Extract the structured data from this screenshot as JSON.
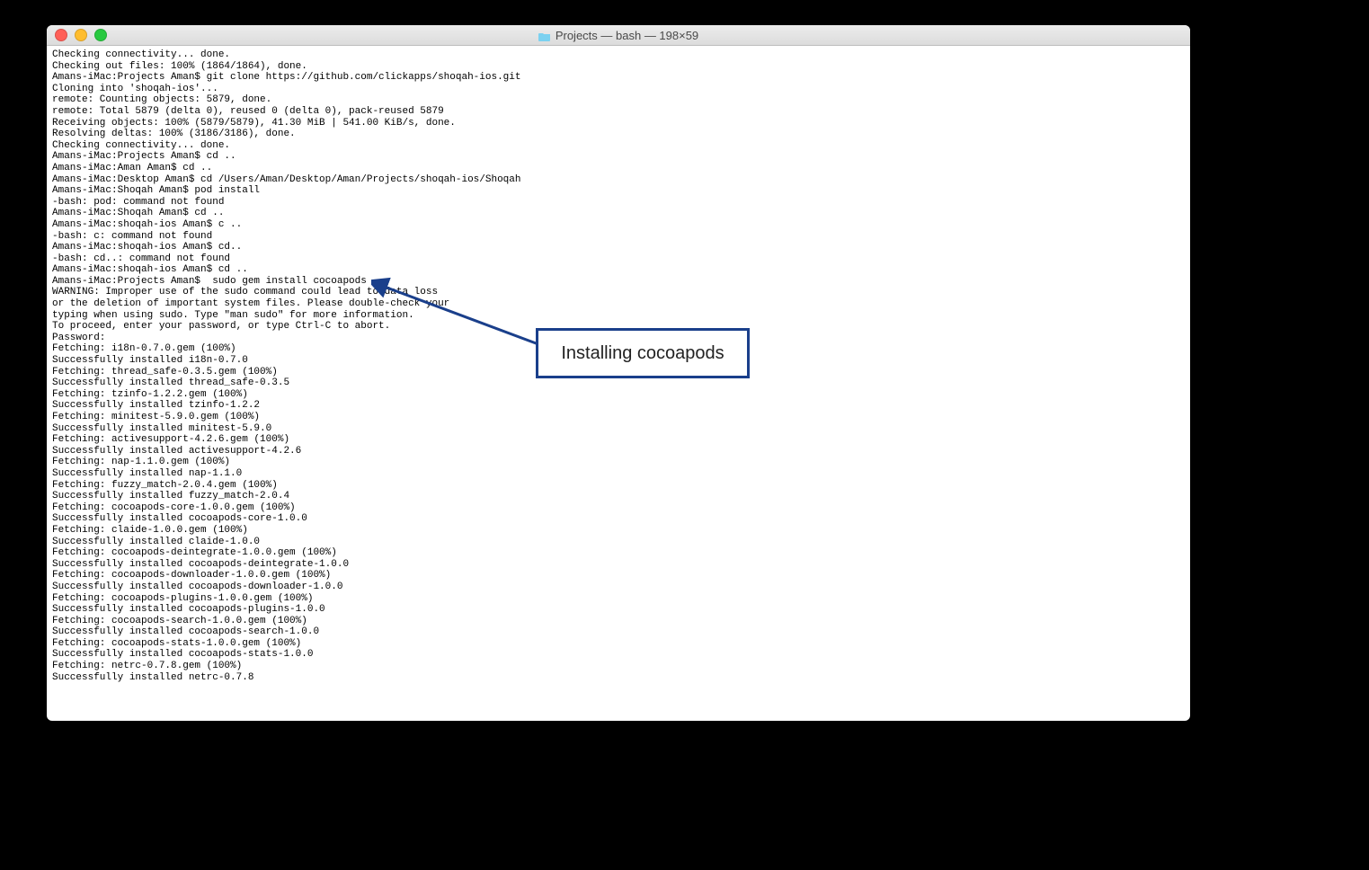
{
  "window": {
    "title": "Projects — bash — 198×59"
  },
  "annotation": {
    "label": "Installing cocoapods"
  },
  "terminal": {
    "lines": [
      "Checking connectivity... done.",
      "Checking out files: 100% (1864/1864), done.",
      "Amans-iMac:Projects Aman$ git clone https://github.com/clickapps/shoqah-ios.git",
      "Cloning into 'shoqah-ios'...",
      "remote: Counting objects: 5879, done.",
      "remote: Total 5879 (delta 0), reused 0 (delta 0), pack-reused 5879",
      "Receiving objects: 100% (5879/5879), 41.30 MiB | 541.00 KiB/s, done.",
      "Resolving deltas: 100% (3186/3186), done.",
      "Checking connectivity... done.",
      "Amans-iMac:Projects Aman$ cd ..",
      "Amans-iMac:Aman Aman$ cd ..",
      "Amans-iMac:Desktop Aman$ cd /Users/Aman/Desktop/Aman/Projects/shoqah-ios/Shoqah",
      "Amans-iMac:Shoqah Aman$ pod install",
      "-bash: pod: command not found",
      "Amans-iMac:Shoqah Aman$ cd ..",
      "Amans-iMac:shoqah-ios Aman$ c ..",
      "-bash: c: command not found",
      "Amans-iMac:shoqah-ios Aman$ cd..",
      "-bash: cd..: command not found",
      "Amans-iMac:shoqah-ios Aman$ cd ..",
      "Amans-iMac:Projects Aman$  sudo gem install cocoapods",
      "",
      "WARNING: Improper use of the sudo command could lead to data loss",
      "or the deletion of important system files. Please double-check your",
      "typing when using sudo. Type \"man sudo\" for more information.",
      "",
      "To proceed, enter your password, or type Ctrl-C to abort.",
      "",
      "Password:",
      "Fetching: i18n-0.7.0.gem (100%)",
      "Successfully installed i18n-0.7.0",
      "Fetching: thread_safe-0.3.5.gem (100%)",
      "Successfully installed thread_safe-0.3.5",
      "Fetching: tzinfo-1.2.2.gem (100%)",
      "Successfully installed tzinfo-1.2.2",
      "Fetching: minitest-5.9.0.gem (100%)",
      "Successfully installed minitest-5.9.0",
      "Fetching: activesupport-4.2.6.gem (100%)",
      "Successfully installed activesupport-4.2.6",
      "Fetching: nap-1.1.0.gem (100%)",
      "Successfully installed nap-1.1.0",
      "Fetching: fuzzy_match-2.0.4.gem (100%)",
      "Successfully installed fuzzy_match-2.0.4",
      "Fetching: cocoapods-core-1.0.0.gem (100%)",
      "Successfully installed cocoapods-core-1.0.0",
      "Fetching: claide-1.0.0.gem (100%)",
      "Successfully installed claide-1.0.0",
      "Fetching: cocoapods-deintegrate-1.0.0.gem (100%)",
      "Successfully installed cocoapods-deintegrate-1.0.0",
      "Fetching: cocoapods-downloader-1.0.0.gem (100%)",
      "Successfully installed cocoapods-downloader-1.0.0",
      "Fetching: cocoapods-plugins-1.0.0.gem (100%)",
      "Successfully installed cocoapods-plugins-1.0.0",
      "Fetching: cocoapods-search-1.0.0.gem (100%)",
      "Successfully installed cocoapods-search-1.0.0",
      "Fetching: cocoapods-stats-1.0.0.gem (100%)",
      "Successfully installed cocoapods-stats-1.0.0",
      "Fetching: netrc-0.7.8.gem (100%)",
      "Successfully installed netrc-0.7.8"
    ]
  }
}
